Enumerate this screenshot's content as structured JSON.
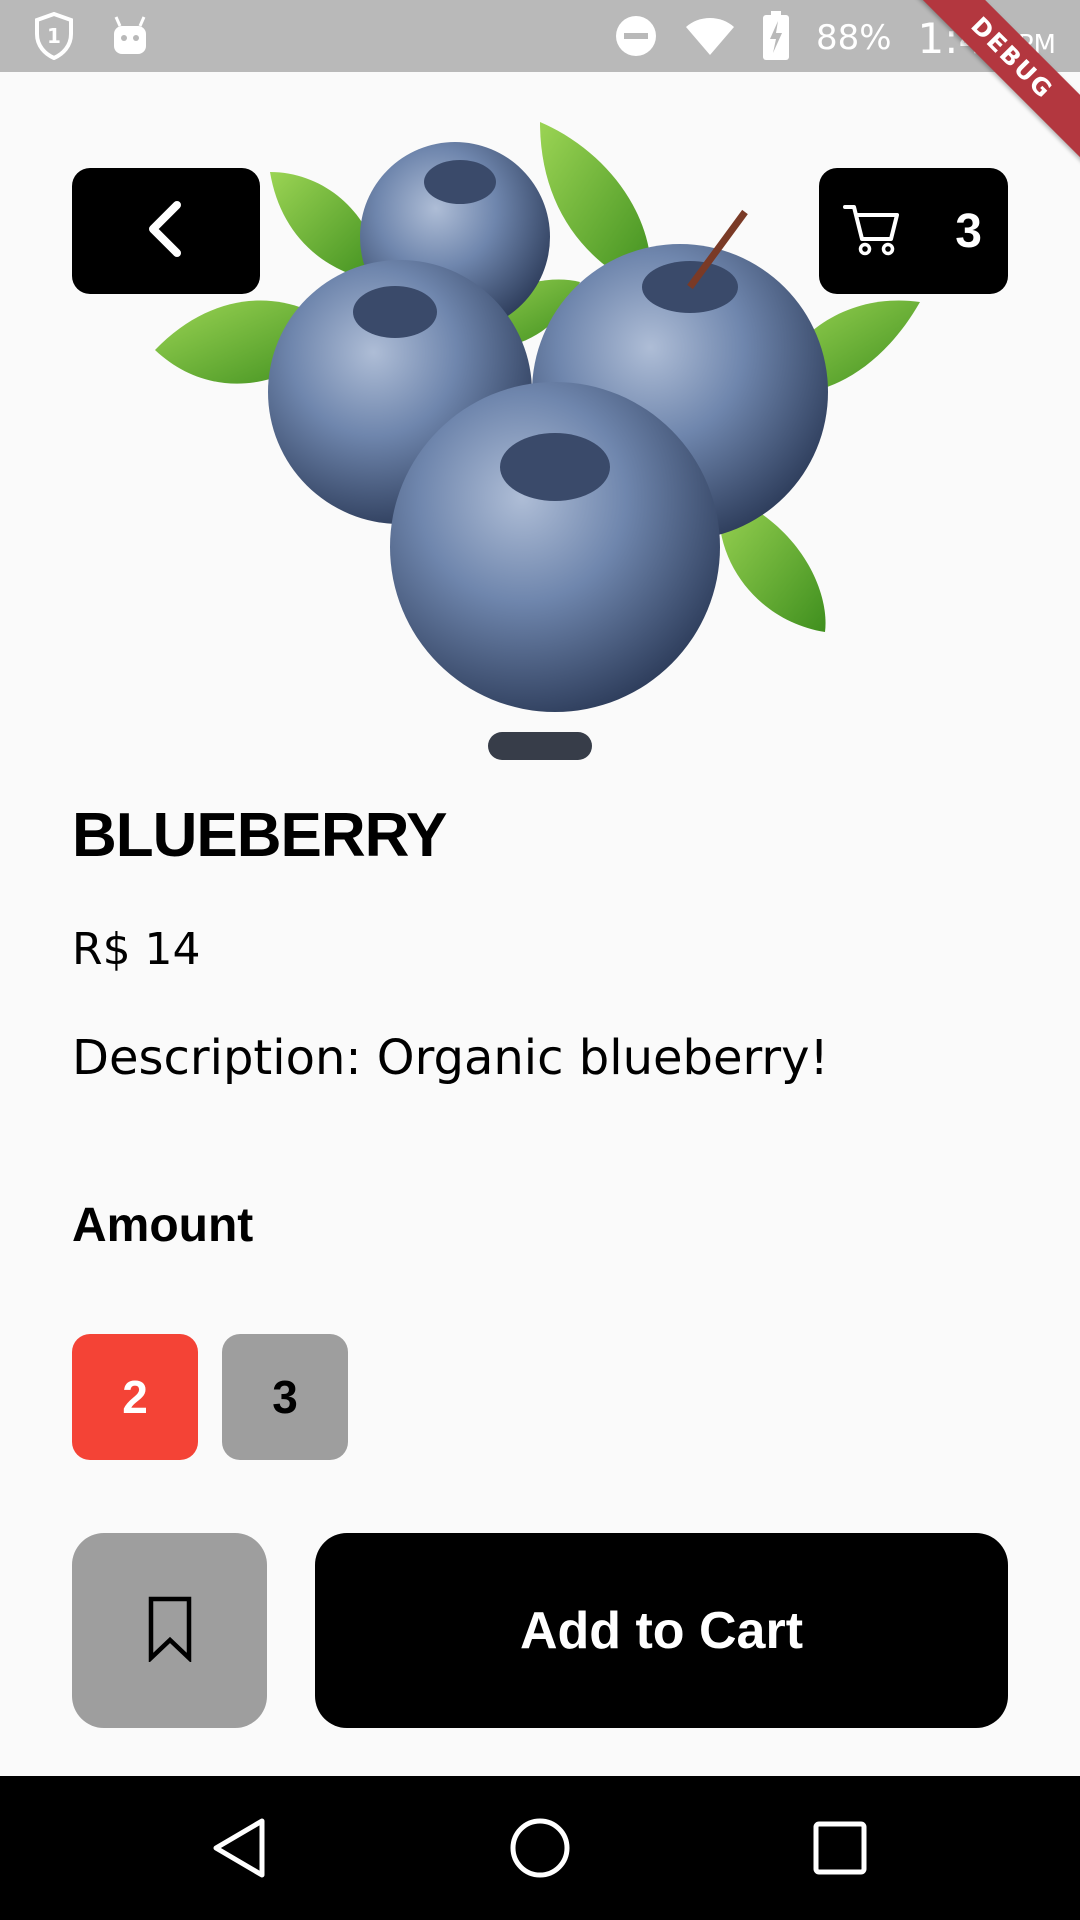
{
  "status_bar": {
    "battery_percent": "88%",
    "time": "1:44",
    "ampm": "PM",
    "icons": [
      "shield-one-icon",
      "android-icon",
      "do-not-disturb-icon",
      "wifi-icon",
      "battery-charging-icon"
    ]
  },
  "debug_banner": "DEBUG",
  "header": {
    "back_icon": "chevron-left-icon",
    "cart_icon": "shopping-cart-icon",
    "cart_count": "3"
  },
  "product": {
    "name": "BLUEBERRY",
    "price": "R$ 14",
    "description": "Description: Organic blueberry!"
  },
  "amount": {
    "label": "Amount",
    "options": [
      "2",
      "3"
    ],
    "selected": "2"
  },
  "actions": {
    "bookmark_icon": "bookmark-icon",
    "add_to_cart_label": "Add to Cart"
  },
  "colors": {
    "selected": "#f44336",
    "unselected": "#9e9e9e",
    "primary": "#000000",
    "background": "#fafafa"
  }
}
